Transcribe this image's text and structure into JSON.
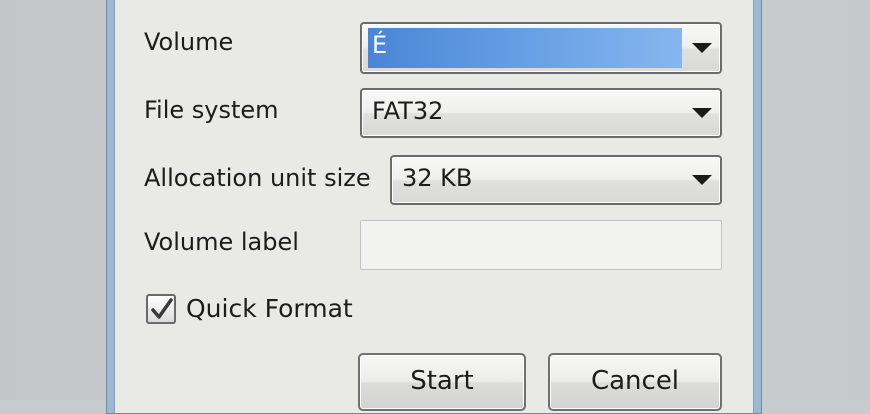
{
  "dialog": {
    "volume": {
      "label": "Volume",
      "value": "É"
    },
    "file_system": {
      "label": "File system",
      "value": "FAT32"
    },
    "allocation_unit": {
      "label": "Allocation unit size",
      "value": "32 KB"
    },
    "volume_label": {
      "label": "Volume label",
      "value": ""
    },
    "quick_format": {
      "label": "Quick Format",
      "checked": true
    },
    "buttons": {
      "start": "Start",
      "cancel": "Cancel"
    }
  },
  "colors": {
    "selection": "#4a86d6",
    "frame": "#9bb8d4",
    "client": "#e9e9e6"
  }
}
